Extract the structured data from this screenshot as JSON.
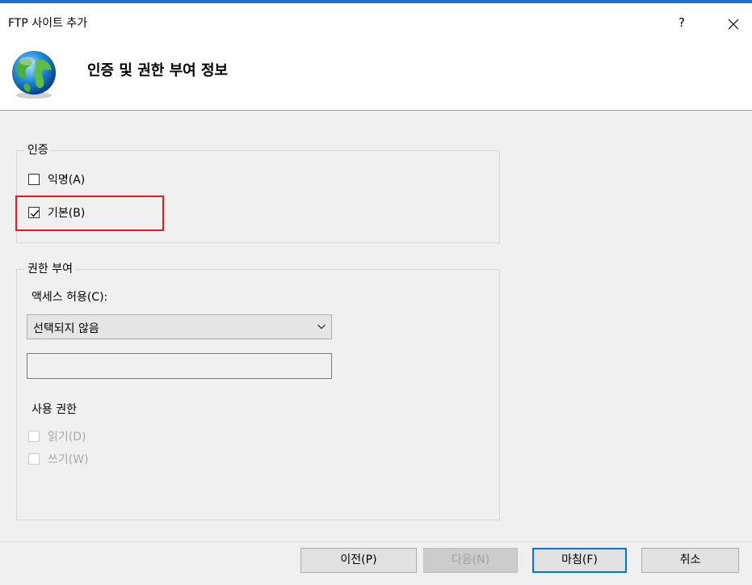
{
  "window": {
    "title": "FTP 사이트 추가",
    "help_label": "?",
    "close_label": "✕"
  },
  "header": {
    "title": "인증 및 권한 부여 정보"
  },
  "authentication": {
    "group_label": "인증",
    "anonymous": {
      "label": "익명(A)",
      "checked": false
    },
    "basic": {
      "label": "기본(B)",
      "checked": true
    }
  },
  "authorization": {
    "group_label": "권한 부여",
    "access_label": "액세스 허용(C):",
    "access_select": {
      "value": "선택되지 않음"
    },
    "access_textbox": {
      "value": ""
    },
    "permissions_label": "사용 권한",
    "read": {
      "label": "읽기(D)",
      "checked": false,
      "enabled": false
    },
    "write": {
      "label": "쓰기(W)",
      "checked": false,
      "enabled": false
    }
  },
  "footer": {
    "previous_label": "이전(P)",
    "next_label": "다음(N)",
    "finish_label": "마침(F)",
    "cancel_label": "취소"
  }
}
